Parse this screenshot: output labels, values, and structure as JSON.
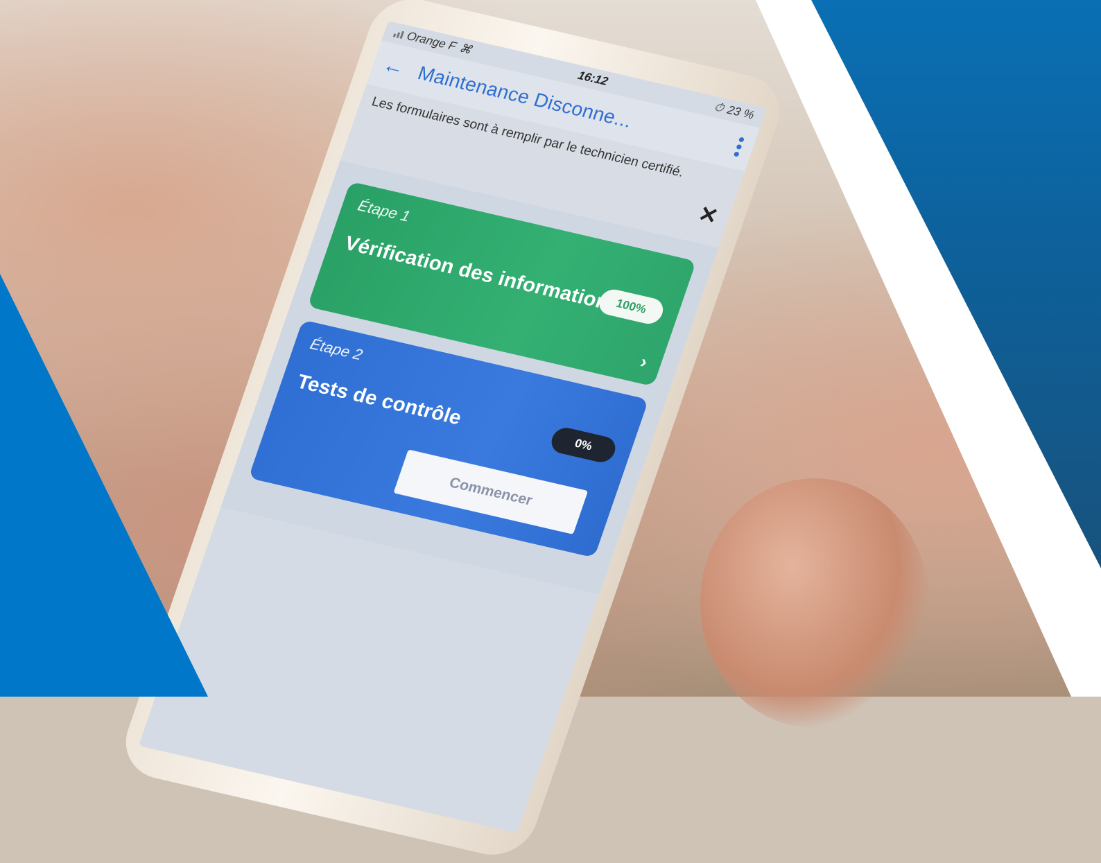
{
  "status_bar": {
    "carrier": "Orange F",
    "time": "16:12",
    "battery": "23 %"
  },
  "header": {
    "title": "Maintenance Disconne..."
  },
  "notice": {
    "text": "Les formulaires sont à remplir par le technicien certifié."
  },
  "steps": [
    {
      "step_label": "Étape 1",
      "title": "Vérification des informations",
      "progress_label": "100%",
      "progress": 100,
      "color": "#2fa86b"
    },
    {
      "step_label": "Étape 2",
      "title": "Tests de contrôle",
      "progress_label": "0%",
      "progress": 0,
      "color": "#3575d8",
      "button_label": "Commencer"
    }
  ],
  "colors": {
    "accent": "#2f6fd0",
    "brand_blue": "#0077c8"
  },
  "icons": {
    "back": "arrow-left-icon",
    "menu": "kebab-icon",
    "close": "close-icon",
    "chevron": "chevron-right-icon",
    "wifi": "wifi-icon",
    "alarm": "alarm-icon"
  }
}
